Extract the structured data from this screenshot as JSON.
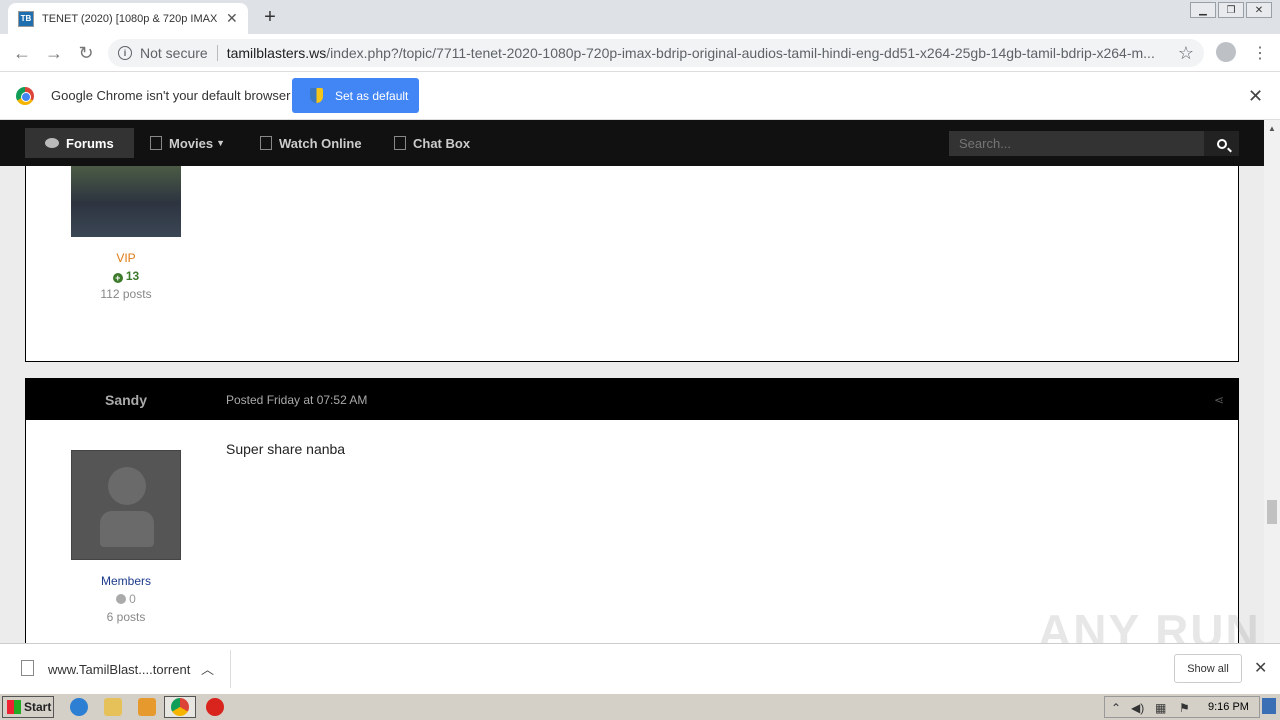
{
  "browser": {
    "tab_title": "TENET (2020) [1080p & 720p IMAX B",
    "tab_favicon": "TB",
    "new_tab": "+",
    "not_secure": "Not secure",
    "url_host": "tamilblasters.ws",
    "url_path": "/index.php?/topic/7711-tenet-2020-1080p-720p-imax-bdrip-original-audios-tamil-hindi-eng-dd51-x264-25gb-14gb-tamil-bdrip-x264-m..."
  },
  "infobar": {
    "message": "Google Chrome isn't your default browser",
    "button": "Set as default"
  },
  "sitenav": {
    "items": [
      {
        "label": "Forums"
      },
      {
        "label": "Movies"
      },
      {
        "label": "Watch Online"
      },
      {
        "label": "Chat Box"
      }
    ],
    "search_placeholder": "Search..."
  },
  "posts": [
    {
      "rank": "VIP",
      "reputation": "13",
      "post_count": "112 posts"
    },
    {
      "author": "Sandy",
      "posted": "Posted Friday at 07:52 AM",
      "body": "Super share nanba",
      "rank": "Members",
      "reputation": "0",
      "post_count": "6 posts"
    }
  ],
  "downloads": {
    "file_name": "www.TamilBlast....torrent",
    "show_all": "Show all"
  },
  "watermark": "ANY RUN",
  "taskbar": {
    "start": "Start",
    "clock": "9:16 PM"
  },
  "colors": {
    "vip": "#e07b12",
    "members": "#1c3b8a",
    "rep_positive": "#3d7a2b",
    "accent": "#4285f4"
  }
}
